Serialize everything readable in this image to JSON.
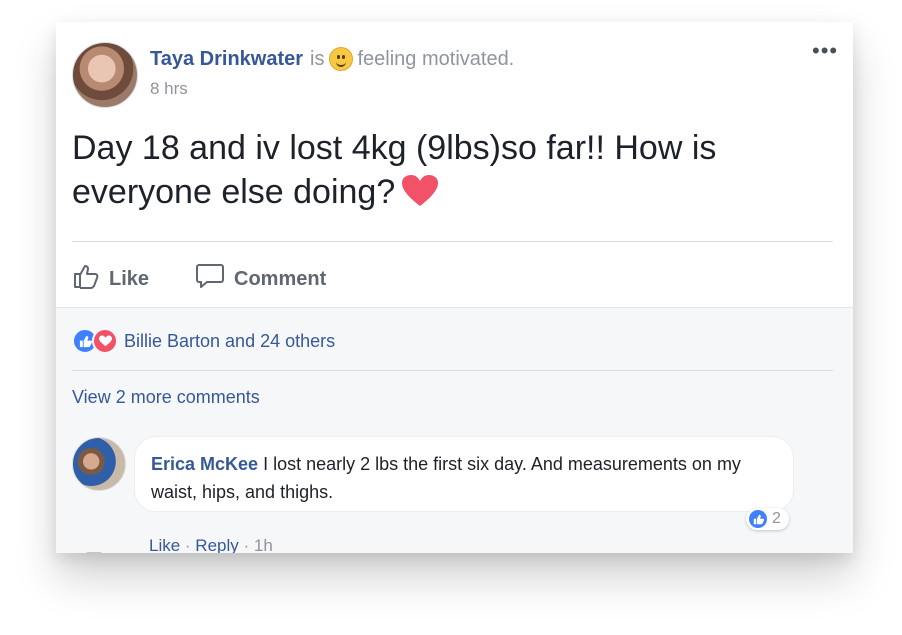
{
  "post": {
    "author": "Taya Drinkwater",
    "is_text": "is",
    "feeling": "feeling motivated.",
    "time": "8 hrs",
    "more_icon": "•••",
    "text": "Day 18 and iv lost 4kg (9lbs)so far!! How is everyone else doing?"
  },
  "actions": {
    "like_label": "Like",
    "comment_label": "Comment"
  },
  "reactions": {
    "summary": "Billie Barton and 24 others"
  },
  "comments": {
    "view_more": "View 2 more comments",
    "items": [
      {
        "author": "Erica McKee",
        "text": "I lost nearly 2 lbs the first six day. And measurements on my waist, hips, and thighs.",
        "like_label": "Like",
        "separator1": " · ",
        "reply_label": "Reply",
        "separator2": " · ",
        "time": "1h",
        "reaction_count": "2"
      }
    ]
  },
  "colors": {
    "link": "#365899",
    "like_blue": "#4080ff",
    "love_red": "#f25268",
    "secondary_text": "#90949c"
  }
}
